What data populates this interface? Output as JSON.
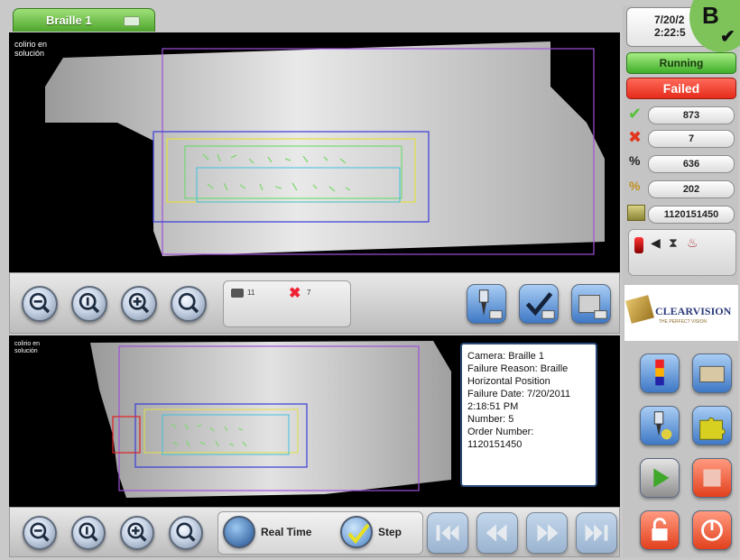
{
  "tab": {
    "label": "Braille 1"
  },
  "top_view": {
    "label": "colirio en\nsolución"
  },
  "bottom_view": {
    "label": "colirio en\nsolución"
  },
  "thumb": {
    "count_text": "11",
    "fail_text": "7"
  },
  "status": {
    "date": "7/20/2",
    "time": "2:22:5",
    "state": "Running",
    "result": "Failed"
  },
  "counters": {
    "passed": "873",
    "failed": "7",
    "metric_a": "636",
    "metric_b": "202",
    "order": "1120151450"
  },
  "logo": {
    "text": "CLEARVISION",
    "tagline": "THE PERFECT VISION"
  },
  "corner_badge": {
    "text": "B"
  },
  "info": {
    "lines": [
      "Camera: Braille 1",
      "Failure Reason: Braille",
      "Horizontal Position",
      "Failure Date: 7/20/2011",
      "2:18:51 PM",
      "Number: 5",
      "Order Number:",
      "1120151450"
    ]
  },
  "controls": {
    "realtime": "Real Time",
    "step": "Step"
  },
  "colors": {
    "tab_green": "#4fa52c",
    "running": "#3fae2a",
    "failed": "#e52b1a",
    "accent_blue": "#3e78c5"
  }
}
